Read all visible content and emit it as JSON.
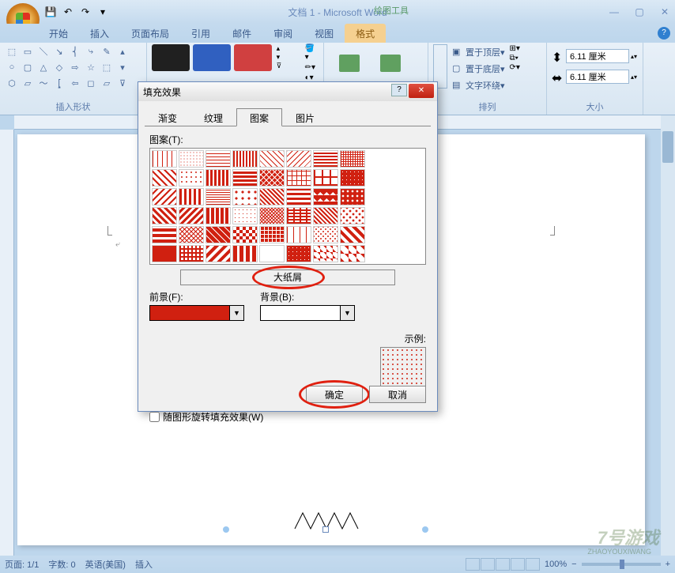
{
  "window": {
    "title": "文档 1 - Microsoft Word",
    "contextual_tab_label": "绘图工具"
  },
  "ribbon": {
    "tabs": [
      "开始",
      "插入",
      "页面布局",
      "引用",
      "邮件",
      "审阅",
      "视图",
      "格式"
    ],
    "active_tab": "格式",
    "groups": {
      "shapes_label": "插入形状",
      "arrange_label": "排列",
      "size_label": "大小",
      "bring_front": "置于顶层",
      "send_back": "置于底层",
      "text_wrap": "文字环绕",
      "height_value": "6.11 厘米",
      "width_value": "6.11 厘米"
    }
  },
  "dialog": {
    "title": "填充效果",
    "tabs": [
      "渐变",
      "纹理",
      "图案",
      "图片"
    ],
    "active_tab": "图案",
    "pattern_label": "图案(T):",
    "selected_pattern_name": "大纸屑",
    "foreground_label": "前景(F):",
    "background_label": "背景(B):",
    "foreground_color": "#d02010",
    "background_color": "#ffffff",
    "sample_label": "示例:",
    "rotate_label": "随图形旋转填充效果(W)",
    "ok_btn": "确定",
    "cancel_btn": "取消"
  },
  "statusbar": {
    "page": "页面: 1/1",
    "words": "字数: 0",
    "lang": "英语(美国)",
    "mode": "插入",
    "zoom": "100%"
  },
  "watermark": {
    "big": "7号游戏",
    "small": "ZHAOYOUXIWANG"
  }
}
